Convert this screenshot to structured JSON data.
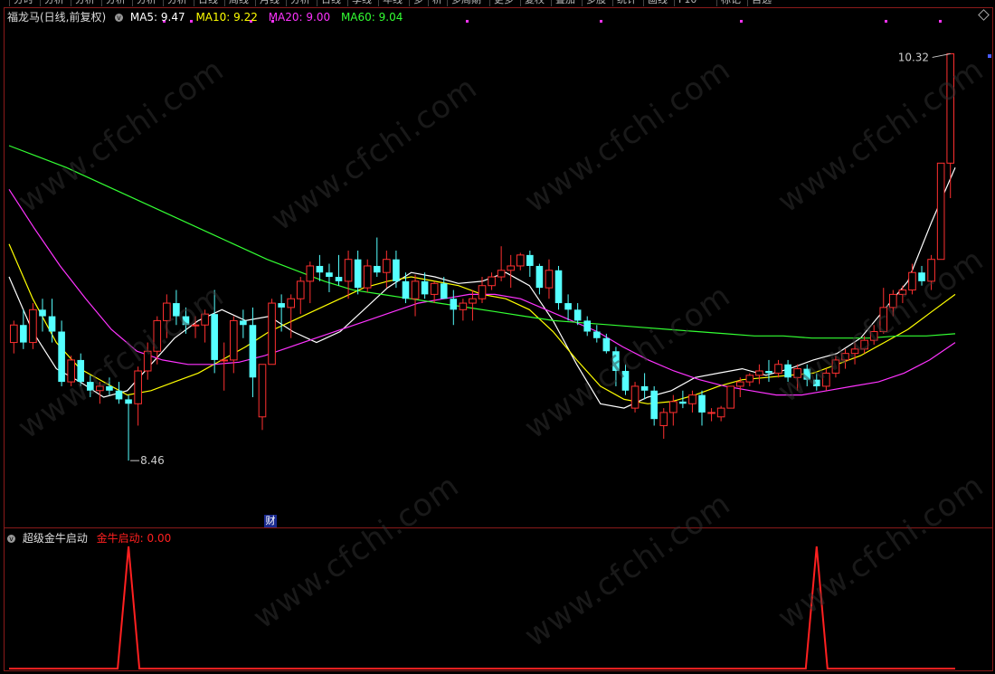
{
  "toolbar": {
    "items": [
      "分时",
      "分析",
      "分析",
      "分析",
      "分析",
      "分析",
      "日线",
      "周线",
      "月线",
      "分析",
      "日线",
      "季线",
      "年线",
      "多",
      "析",
      "多周期",
      "更多",
      "复权",
      "叠加",
      "多股",
      "统计",
      "画线",
      "F10",
      "标记",
      "自选"
    ]
  },
  "main": {
    "stock_title": "福龙马(日线,前复权)",
    "legend": [
      {
        "label": "MA5: 9.47",
        "color": "#ffffff"
      },
      {
        "label": "MA10: 9.22",
        "color": "#ffff00"
      },
      {
        "label": "MA20: 9.00",
        "color": "#ff33ff"
      },
      {
        "label": "MA60: 9.04",
        "color": "#33ff33"
      }
    ],
    "high_label": "10.32",
    "low_label": "8.46",
    "finance_marker": "财"
  },
  "sub": {
    "indicator_name": "超级金牛启动",
    "series_label": "金牛启动: 0.00",
    "series_color": "#ff2020"
  },
  "watermark": "www.cfchi.com",
  "chart_data": [
    {
      "type": "candlestick",
      "title": "福龙马(日线,前复权)",
      "ylim": [
        8.2,
        10.45
      ],
      "up_color": "#ff3030",
      "down_color": "#55ffff",
      "candles": [
        [
          9.0,
          9.1,
          8.95,
          9.08
        ],
        [
          9.08,
          9.15,
          8.97,
          9.0
        ],
        [
          9.0,
          9.18,
          8.97,
          9.15
        ],
        [
          9.15,
          9.2,
          9.05,
          9.12
        ],
        [
          9.12,
          9.2,
          9.0,
          9.05
        ],
        [
          9.05,
          9.1,
          8.8,
          8.82
        ],
        [
          8.82,
          8.94,
          8.8,
          8.92
        ],
        [
          8.92,
          8.95,
          8.8,
          8.82
        ],
        [
          8.82,
          8.85,
          8.75,
          8.78
        ],
        [
          8.78,
          8.82,
          8.72,
          8.8
        ],
        [
          8.8,
          8.84,
          8.76,
          8.78
        ],
        [
          8.78,
          8.82,
          8.72,
          8.74
        ],
        [
          8.74,
          8.76,
          8.46,
          8.72
        ],
        [
          8.72,
          8.89,
          8.62,
          8.87
        ],
        [
          8.87,
          9.0,
          8.83,
          8.96
        ],
        [
          8.96,
          9.12,
          8.9,
          9.1
        ],
        [
          9.1,
          9.22,
          9.02,
          9.18
        ],
        [
          9.18,
          9.24,
          9.08,
          9.12
        ],
        [
          9.12,
          9.16,
          9.04,
          9.08
        ],
        [
          9.08,
          9.12,
          9.02,
          9.08
        ],
        [
          9.08,
          9.15,
          9.0,
          9.13
        ],
        [
          9.13,
          9.24,
          8.86,
          8.92
        ],
        [
          8.92,
          9.0,
          8.78,
          8.92
        ],
        [
          8.92,
          9.12,
          8.86,
          9.1
        ],
        [
          9.1,
          9.15,
          9.02,
          9.08
        ],
        [
          9.08,
          9.16,
          8.75,
          8.84
        ],
        [
          8.66,
          8.9,
          8.6,
          8.9
        ],
        [
          8.9,
          9.2,
          8.9,
          9.18
        ],
        [
          9.18,
          9.22,
          9.05,
          9.16
        ],
        [
          9.16,
          9.22,
          9.02,
          9.2
        ],
        [
          9.2,
          9.3,
          9.13,
          9.28
        ],
        [
          9.28,
          9.37,
          9.18,
          9.35
        ],
        [
          9.35,
          9.4,
          9.28,
          9.32
        ],
        [
          9.32,
          9.36,
          9.23,
          9.3
        ],
        [
          9.3,
          9.4,
          9.26,
          9.28
        ],
        [
          9.28,
          9.42,
          9.2,
          9.38
        ],
        [
          9.38,
          9.42,
          9.22,
          9.25
        ],
        [
          9.25,
          9.38,
          9.23,
          9.35
        ],
        [
          9.35,
          9.48,
          9.3,
          9.32
        ],
        [
          9.32,
          9.42,
          9.25,
          9.38
        ],
        [
          9.38,
          9.42,
          9.25,
          9.28
        ],
        [
          9.28,
          9.32,
          9.18,
          9.2
        ],
        [
          9.2,
          9.31,
          9.12,
          9.28
        ],
        [
          9.28,
          9.32,
          9.2,
          9.22
        ],
        [
          9.22,
          9.28,
          9.18,
          9.27
        ],
        [
          9.27,
          9.3,
          9.2,
          9.2
        ],
        [
          9.2,
          9.24,
          9.08,
          9.15
        ],
        [
          9.15,
          9.2,
          9.1,
          9.18
        ],
        [
          9.18,
          9.24,
          9.1,
          9.2
        ],
        [
          9.2,
          9.3,
          9.18,
          9.26
        ],
        [
          9.26,
          9.32,
          9.24,
          9.3
        ],
        [
          9.3,
          9.44,
          9.28,
          9.33
        ],
        [
          9.33,
          9.4,
          9.25,
          9.35
        ],
        [
          9.35,
          9.41,
          9.33,
          9.4
        ],
        [
          9.4,
          9.42,
          9.3,
          9.35
        ],
        [
          9.35,
          9.36,
          9.22,
          9.25
        ],
        [
          9.25,
          9.38,
          9.2,
          9.33
        ],
        [
          9.33,
          9.35,
          9.15,
          9.18
        ],
        [
          9.18,
          9.22,
          9.1,
          9.15
        ],
        [
          9.15,
          9.18,
          9.08,
          9.1
        ],
        [
          9.1,
          9.12,
          9.03,
          9.05
        ],
        [
          9.05,
          9.08,
          9.0,
          9.02
        ],
        [
          9.02,
          9.04,
          8.95,
          8.96
        ],
        [
          8.96,
          8.98,
          8.8,
          8.87
        ],
        [
          8.87,
          8.9,
          8.76,
          8.78
        ],
        [
          8.7,
          8.82,
          8.68,
          8.8
        ],
        [
          8.8,
          8.86,
          8.74,
          8.78
        ],
        [
          8.78,
          8.8,
          8.62,
          8.65
        ],
        [
          8.62,
          8.7,
          8.56,
          8.68
        ],
        [
          8.68,
          8.76,
          8.62,
          8.73
        ],
        [
          8.73,
          8.78,
          8.7,
          8.72
        ],
        [
          8.72,
          8.78,
          8.68,
          8.76
        ],
        [
          8.76,
          8.78,
          8.62,
          8.68
        ],
        [
          8.68,
          8.7,
          8.64,
          8.68
        ],
        [
          8.66,
          8.71,
          8.64,
          8.7
        ],
        [
          8.7,
          8.8,
          8.7,
          8.8
        ],
        [
          8.8,
          8.84,
          8.75,
          8.82
        ],
        [
          8.82,
          8.86,
          8.8,
          8.85
        ],
        [
          8.85,
          8.9,
          8.81,
          8.87
        ],
        [
          8.87,
          8.92,
          8.82,
          8.86
        ],
        [
          8.86,
          8.92,
          8.84,
          8.9
        ],
        [
          8.9,
          8.92,
          8.82,
          8.84
        ],
        [
          8.84,
          8.9,
          8.78,
          8.88
        ],
        [
          8.88,
          8.9,
          8.8,
          8.83
        ],
        [
          8.83,
          8.86,
          8.78,
          8.8
        ],
        [
          8.8,
          8.88,
          8.78,
          8.86
        ],
        [
          8.86,
          8.94,
          8.84,
          8.92
        ],
        [
          8.92,
          8.97,
          8.88,
          8.95
        ],
        [
          8.95,
          9.0,
          8.9,
          8.97
        ],
        [
          8.97,
          9.03,
          8.95,
          9.01
        ],
        [
          9.01,
          9.08,
          8.99,
          9.05
        ],
        [
          9.05,
          9.25,
          9.04,
          9.16
        ],
        [
          9.16,
          9.24,
          9.12,
          9.22
        ],
        [
          9.22,
          9.26,
          9.18,
          9.24
        ],
        [
          9.24,
          9.36,
          9.22,
          9.32
        ],
        [
          9.32,
          9.35,
          9.26,
          9.28
        ],
        [
          9.28,
          9.4,
          9.24,
          9.38
        ],
        [
          9.38,
          9.82,
          9.45,
          9.82
        ],
        [
          9.82,
          10.32,
          9.66,
          10.32
        ]
      ],
      "series": [
        {
          "name": "MA5",
          "color": "#ffffff",
          "values": [
            9.3,
            9.05,
            8.88,
            8.82,
            8.75,
            8.78,
            8.9,
            9.02,
            9.1,
            9.15,
            9.1,
            9.12,
            9.05,
            9.0,
            9.05,
            9.15,
            9.25,
            9.32,
            9.3,
            9.27,
            9.28,
            9.32,
            9.26,
            9.1,
            8.9,
            8.72,
            8.7,
            8.75,
            8.78,
            8.84,
            8.86,
            8.88,
            8.85,
            8.88,
            8.92,
            8.95,
            9.02,
            9.15,
            9.28,
            9.55,
            9.8
          ]
        },
        {
          "name": "MA10",
          "color": "#ffff00",
          "values": [
            9.45,
            9.2,
            9.0,
            8.88,
            8.82,
            8.76,
            8.78,
            8.82,
            8.86,
            8.92,
            8.98,
            9.05,
            9.1,
            9.15,
            9.2,
            9.25,
            9.28,
            9.3,
            9.28,
            9.26,
            9.22,
            9.2,
            9.15,
            9.05,
            8.92,
            8.8,
            8.74,
            8.72,
            8.73,
            8.76,
            8.8,
            8.83,
            8.84,
            8.85,
            8.86,
            8.9,
            8.94,
            9.0,
            9.06,
            9.14,
            9.22
          ]
        },
        {
          "name": "MA20",
          "color": "#ff33ff",
          "values": [
            9.7,
            9.52,
            9.35,
            9.2,
            9.06,
            8.96,
            8.92,
            8.9,
            8.9,
            8.91,
            8.94,
            8.98,
            9.02,
            9.06,
            9.1,
            9.14,
            9.18,
            9.2,
            9.22,
            9.22,
            9.2,
            9.15,
            9.1,
            9.05,
            8.98,
            8.92,
            8.87,
            8.83,
            8.8,
            8.78,
            8.76,
            8.76,
            8.78,
            8.8,
            8.82,
            8.86,
            8.92,
            9.0
          ]
        },
        {
          "name": "MA60",
          "color": "#33ff33",
          "values": [
            9.9,
            9.85,
            9.8,
            9.74,
            9.68,
            9.62,
            9.56,
            9.5,
            9.44,
            9.38,
            9.33,
            9.28,
            9.24,
            9.22,
            9.2,
            9.18,
            9.16,
            9.14,
            9.12,
            9.1,
            9.09,
            9.08,
            9.07,
            9.06,
            9.05,
            9.04,
            9.03,
            9.03,
            9.02,
            9.02,
            9.02,
            9.03,
            9.03,
            9.04
          ]
        }
      ]
    },
    {
      "type": "line",
      "title": "超级金牛启动",
      "ylim": [
        0,
        1
      ],
      "series": [
        {
          "name": "金牛启动",
          "color": "#ff2020",
          "spikes_at": [
            12,
            84
          ],
          "values_peak": 1,
          "values_base": 0
        }
      ]
    }
  ]
}
